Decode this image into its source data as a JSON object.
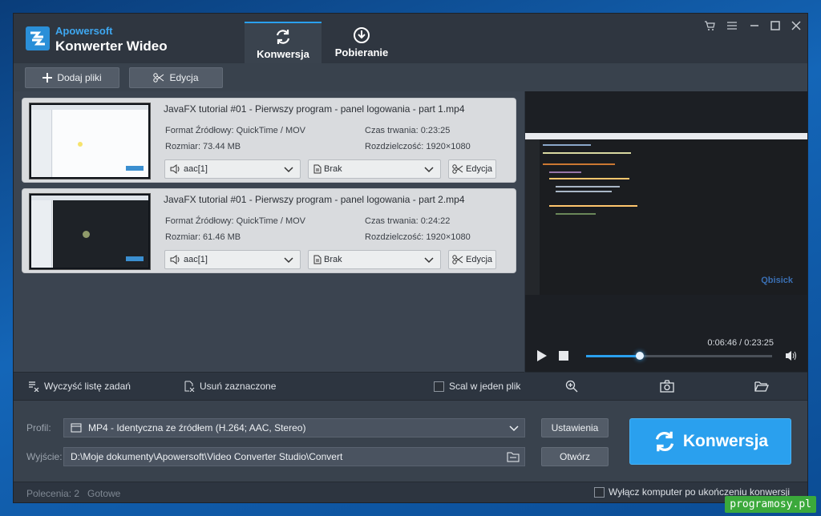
{
  "app": {
    "brand_top": "Apowersoft",
    "brand_name": "Konwerter Wideo",
    "accent_color": "#2aa0ee"
  },
  "tabs": [
    {
      "label": "Konwersja",
      "icon": "refresh-icon",
      "active": true
    },
    {
      "label": "Pobieranie",
      "icon": "download-icon",
      "active": false
    }
  ],
  "window_controls": [
    "cart-icon",
    "menu-icon",
    "minimize-icon",
    "maximize-icon",
    "close-icon"
  ],
  "toolbar": {
    "add_label": "Dodaj pliki",
    "edit_label": "Edycja"
  },
  "items": [
    {
      "title": "JavaFX tutorial #01 - Pierwszy program - panel logowania - part 1.mp4",
      "format": "Format Źródłowy: QuickTime / MOV",
      "duration": "Czas trwania: 0:23:25",
      "size": "Rozmiar: 73.44 MB",
      "resolution": "Rozdzielczość: 1920×1080",
      "audio": "aac[1]",
      "subtitle": "Brak",
      "edit": "Edycja"
    },
    {
      "title": "JavaFX tutorial #01 - Pierwszy program - panel logowania - part 2.mp4",
      "format": "Format Źródłowy: QuickTime / MOV",
      "duration": "Czas trwania: 0:24:22",
      "size": "Rozmiar: 61.46 MB",
      "resolution": "Rozdzielczość: 1920×1080",
      "audio": "aac[1]",
      "subtitle": "Brak",
      "edit": "Edycja"
    }
  ],
  "preview": {
    "time": "0:06:46 / 0:23:25",
    "progress": 0.29,
    "watermark": "Qbisick"
  },
  "listbar": {
    "clear_label": "Wyczyść listę zadań",
    "remove_label": "Usuń zaznaczone",
    "merge_label": "Scal w jeden plik"
  },
  "output": {
    "profile_label": "Profil:",
    "profile_value": "MP4 - Identyczna ze źródłem (H.264; AAC, Stereo)",
    "settings_label": "Ustawienia",
    "output_label": "Wyjście:",
    "output_value": "D:\\Moje dokumenty\\Apowersoft\\Video Converter Studio\\Convert",
    "open_label": "Otwórz",
    "convert_label": "Konwersja"
  },
  "status": {
    "commands": "Polecenia: 2",
    "ready": "Gotowe",
    "shutdown_label": "Wyłącz komputer po ukończeniu konwersji"
  },
  "site_watermark": "programosy.pl"
}
